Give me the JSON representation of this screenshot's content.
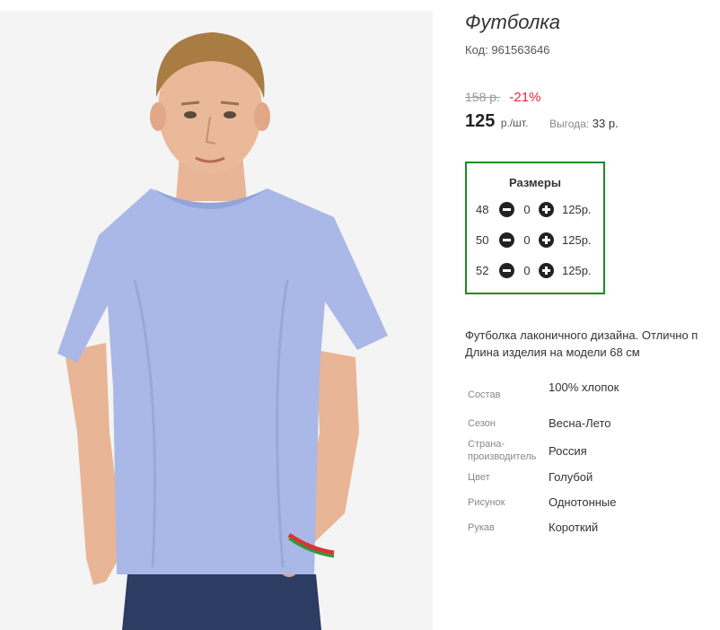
{
  "product": {
    "image_alt": "Young man wearing a light blue short-sleeve t-shirt and jeans",
    "title": "Футболка",
    "code_label": "Код:",
    "code_value": "961563646",
    "old_price": "158 р.",
    "discount": "-21%",
    "price": "125",
    "price_unit": "р./шт.",
    "savings_label": "Выгода:",
    "savings_value": "33 р."
  },
  "sizes": {
    "title": "Размеры",
    "rows": [
      {
        "size": "48",
        "qty": "0",
        "price": "125р."
      },
      {
        "size": "50",
        "qty": "0",
        "price": "125р."
      },
      {
        "size": "52",
        "qty": "0",
        "price": "125р."
      }
    ]
  },
  "description": {
    "line1": "Футболка лаконичного дизайна. Отлично п",
    "line2": "Длина изделия на модели 68 см"
  },
  "attributes": [
    {
      "key": "Состав",
      "value": "100% хлопок"
    },
    {
      "key": "Сезон",
      "value": "Весна-Лето"
    },
    {
      "key": "Страна-производитель",
      "value": "Россия"
    },
    {
      "key": "Цвет",
      "value": "Голубой"
    },
    {
      "key": "Рисунок",
      "value": "Однотонные"
    },
    {
      "key": "Рукав",
      "value": "Короткий"
    }
  ],
  "colors": {
    "accent_border": "#1f8a24",
    "discount": "#e2243b",
    "shirt": "#a9b8e6"
  }
}
